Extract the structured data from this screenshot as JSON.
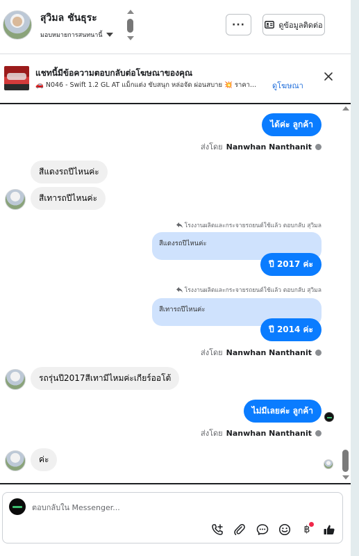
{
  "header": {
    "contact_name": "สุวิมล ชันธุระ",
    "assign_label": "มอบหมายการสนทนานี้",
    "more_label": "···",
    "contact_info_button": "ดูข้อมูลติดต่อ"
  },
  "ad": {
    "title": "แชทนี้มีข้อความตอบกลับต่อโฆษณาของคุณ",
    "subtitle": "🚗 N046 - Swift 1.2 GL AT แม็กแต่ง ขับสนุก หล่อจัด ผ่อนสบาย 💥 ราคา...",
    "view_ad_link": "ดูโฆษณา",
    "close_icon": "close-icon"
  },
  "messages": {
    "m1": "ได้ค่ะ  ลูกค้า",
    "sent_by_prefix": "ส่งโดย",
    "sender_name": "Nanwhan Nanthanit",
    "m2": "สีแดงรถปีไหนค่ะ",
    "m3": "สีเทารถปีไหนค่ะ",
    "reply_note": "โรงงานผลิตและกระจายรถยนต์ใช้แล้ว ตอบกลับ สุวิมล",
    "quote1": "สีแดงรถปีไหนค่ะ",
    "m4": "ปี 2017 ค่ะ",
    "quote2": "สีเทารถปีไหนค่ะ",
    "m5": "ปี 2014 ค่ะ",
    "m6": "รถรุ่นปี2017สีเทามีไหมค่ะเกียร์ออโต้",
    "m7": "ไม่มีเลยค่ะ  ลูกค้า",
    "m8": "ค่ะ"
  },
  "composer": {
    "placeholder": "ตอบกลับใน Messenger...",
    "baht_symbol": "฿"
  },
  "colors": {
    "outgoing_bubble": "#0a7cff",
    "incoming_bubble": "#f0f0f0",
    "quoted_bubble": "#cfe2fd",
    "link": "#216fdb",
    "like_icon": "#1c1e21"
  }
}
